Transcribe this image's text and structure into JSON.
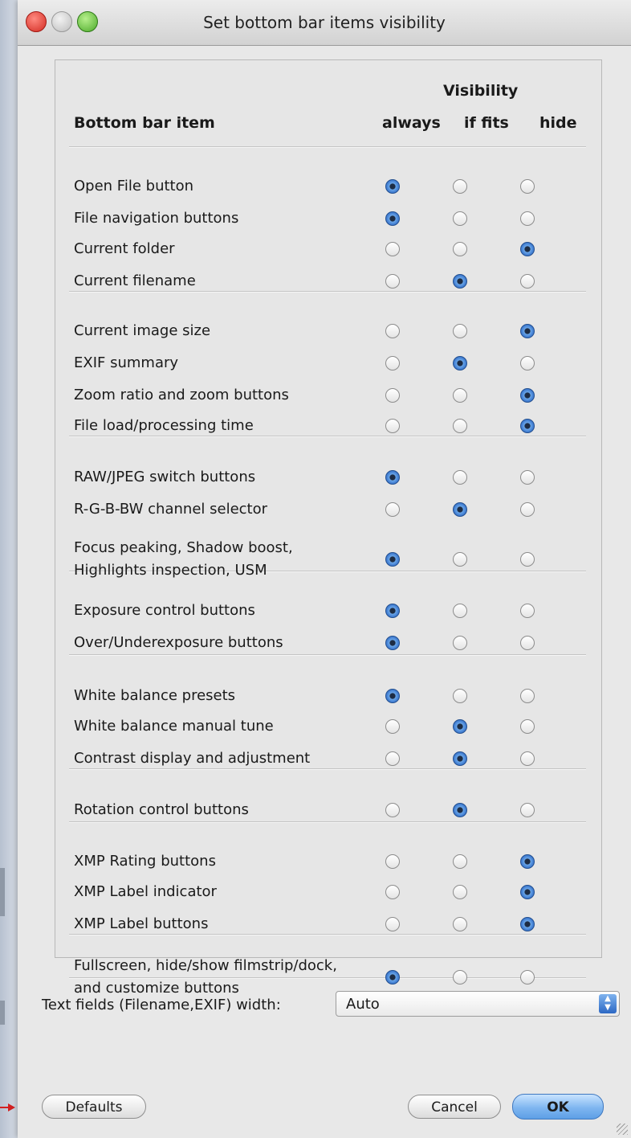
{
  "window": {
    "title": "Set bottom bar items visibility"
  },
  "table": {
    "visibility_header": "Visibility",
    "item_header": "Bottom bar item",
    "columns": [
      "always",
      "if fits",
      "hide"
    ]
  },
  "rows": [
    {
      "label": "Open File button",
      "selected": "always"
    },
    {
      "label": "File navigation buttons",
      "selected": "always"
    },
    {
      "label": "Current folder",
      "selected": "hide"
    },
    {
      "label": "Current filename",
      "selected": "if fits"
    },
    {
      "label": "Current image size",
      "selected": "hide"
    },
    {
      "label": "EXIF summary",
      "selected": "if fits"
    },
    {
      "label": "Zoom ratio and zoom buttons",
      "selected": "hide"
    },
    {
      "label": "File load/processing time",
      "selected": "hide"
    },
    {
      "label": "RAW/JPEG switch buttons",
      "selected": "always"
    },
    {
      "label": "R-G-B-BW channel selector",
      "selected": "if fits"
    },
    {
      "label": "Focus peaking, Shadow boost,\nHighlights inspection, USM",
      "selected": "always"
    },
    {
      "label": "Exposure control buttons",
      "selected": "always"
    },
    {
      "label": "Over/Underexposure buttons",
      "selected": "always"
    },
    {
      "label": "White balance presets",
      "selected": "always"
    },
    {
      "label": "White balance manual tune",
      "selected": "if fits"
    },
    {
      "label": "Contrast display and adjustment",
      "selected": "if fits"
    },
    {
      "label": "Rotation control buttons",
      "selected": "if fits"
    },
    {
      "label": "XMP Rating buttons",
      "selected": "hide"
    },
    {
      "label": "XMP Label indicator",
      "selected": "hide"
    },
    {
      "label": "XMP Label buttons",
      "selected": "hide"
    },
    {
      "label": "Fullscreen, hide/show filmstrip/dock,\nand customize buttons",
      "selected": "always"
    }
  ],
  "text_fields": {
    "label": "Text fields (Filename,EXIF) width:",
    "value": "Auto"
  },
  "buttons": {
    "defaults": "Defaults",
    "cancel": "Cancel",
    "ok": "OK"
  }
}
